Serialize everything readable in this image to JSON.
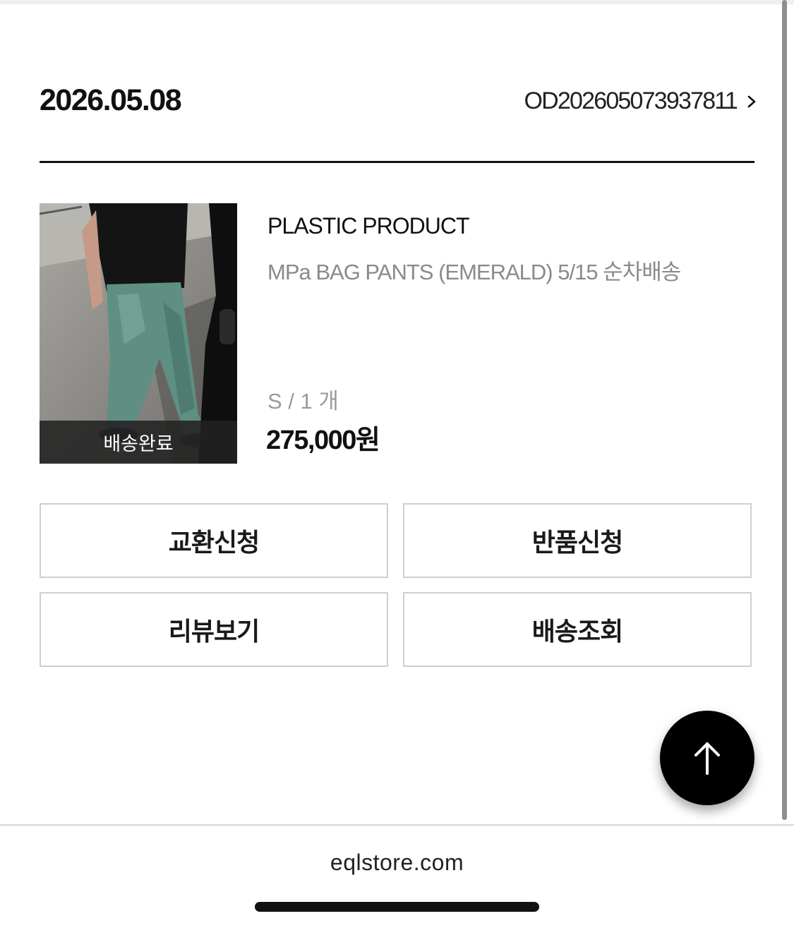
{
  "order": {
    "date": "2026.05.08",
    "number": "OD202605073937811"
  },
  "product": {
    "status": "배송완료",
    "brand": "PLASTIC PRODUCT",
    "name": "MPa BAG PANTS (EMERALD) 5/15 순차배송",
    "option": "S / 1 개",
    "price": "275,000원"
  },
  "actions": {
    "exchange": "교환신청",
    "return": "반품신청",
    "review": "리뷰보기",
    "tracking": "배송조회"
  },
  "browser": {
    "url": "eqlstore.com"
  },
  "icons": {
    "order_link": "chevron-right-icon",
    "scroll_top": "arrow-up-icon"
  }
}
